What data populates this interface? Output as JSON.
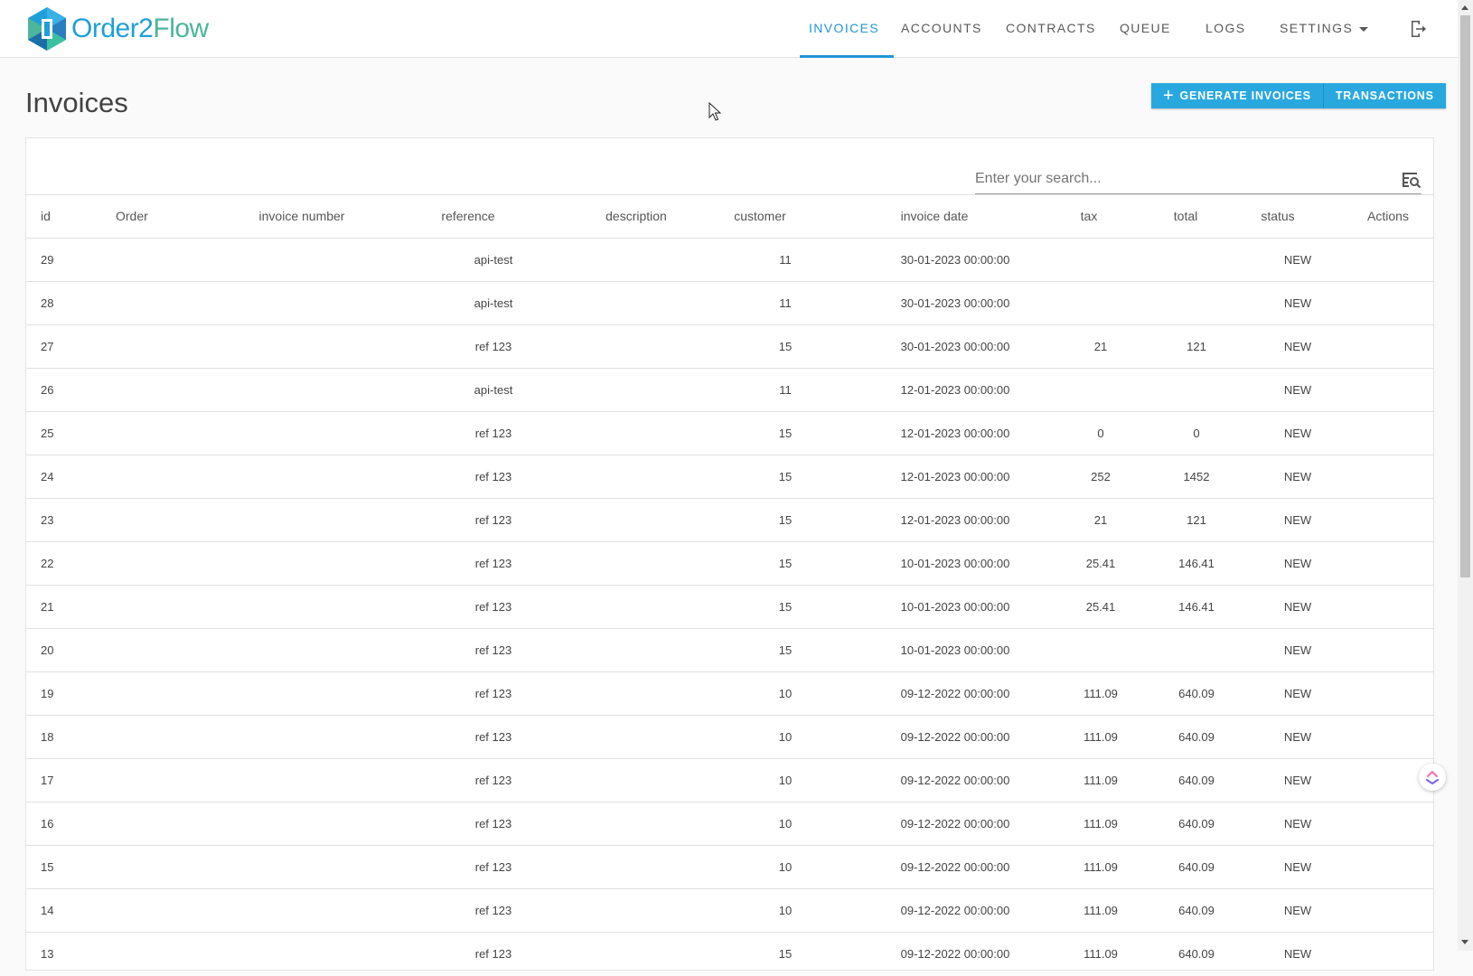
{
  "brand": {
    "name_part1": "Order2",
    "name_part2": "Flow"
  },
  "nav": {
    "items": [
      {
        "label": "INVOICES",
        "active": true
      },
      {
        "label": "ACCOUNTS",
        "active": false
      },
      {
        "label": "CONTRACTS",
        "active": false
      },
      {
        "label": "QUEUE",
        "active": false
      },
      {
        "label": "LOGS",
        "active": false
      },
      {
        "label": "SETTINGS",
        "active": false
      }
    ],
    "logout_icon": "logout-icon"
  },
  "page": {
    "title": "Invoices"
  },
  "actions": {
    "generate_label": "GENERATE INVOICES",
    "transactions_label": "TRANSACTIONS"
  },
  "search": {
    "placeholder": "Enter your search...",
    "value": ""
  },
  "table": {
    "columns": [
      "id",
      "Order",
      "invoice number",
      "reference",
      "description",
      "customer",
      "invoice date",
      "tax",
      "total",
      "status",
      "Actions"
    ],
    "rows": [
      {
        "id": "29",
        "order": "",
        "invoice_number": "",
        "reference": "api-test",
        "description": "",
        "customer": "11",
        "invoice_date": "30-01-2023 00:00:00",
        "tax": "",
        "total": "",
        "status": "NEW"
      },
      {
        "id": "28",
        "order": "",
        "invoice_number": "",
        "reference": "api-test",
        "description": "",
        "customer": "11",
        "invoice_date": "30-01-2023 00:00:00",
        "tax": "",
        "total": "",
        "status": "NEW"
      },
      {
        "id": "27",
        "order": "",
        "invoice_number": "",
        "reference": "ref 123",
        "description": "",
        "customer": "15",
        "invoice_date": "30-01-2023 00:00:00",
        "tax": "21",
        "total": "121",
        "status": "NEW"
      },
      {
        "id": "26",
        "order": "",
        "invoice_number": "",
        "reference": "api-test",
        "description": "",
        "customer": "11",
        "invoice_date": "12-01-2023 00:00:00",
        "tax": "",
        "total": "",
        "status": "NEW"
      },
      {
        "id": "25",
        "order": "",
        "invoice_number": "",
        "reference": "ref 123",
        "description": "",
        "customer": "15",
        "invoice_date": "12-01-2023 00:00:00",
        "tax": "0",
        "total": "0",
        "status": "NEW"
      },
      {
        "id": "24",
        "order": "",
        "invoice_number": "",
        "reference": "ref 123",
        "description": "",
        "customer": "15",
        "invoice_date": "12-01-2023 00:00:00",
        "tax": "252",
        "total": "1452",
        "status": "NEW"
      },
      {
        "id": "23",
        "order": "",
        "invoice_number": "",
        "reference": "ref 123",
        "description": "",
        "customer": "15",
        "invoice_date": "12-01-2023 00:00:00",
        "tax": "21",
        "total": "121",
        "status": "NEW"
      },
      {
        "id": "22",
        "order": "",
        "invoice_number": "",
        "reference": "ref 123",
        "description": "",
        "customer": "15",
        "invoice_date": "10-01-2023 00:00:00",
        "tax": "25.41",
        "total": "146.41",
        "status": "NEW"
      },
      {
        "id": "21",
        "order": "",
        "invoice_number": "",
        "reference": "ref 123",
        "description": "",
        "customer": "15",
        "invoice_date": "10-01-2023 00:00:00",
        "tax": "25.41",
        "total": "146.41",
        "status": "NEW"
      },
      {
        "id": "20",
        "order": "",
        "invoice_number": "",
        "reference": "ref 123",
        "description": "",
        "customer": "15",
        "invoice_date": "10-01-2023 00:00:00",
        "tax": "",
        "total": "",
        "status": "NEW"
      },
      {
        "id": "19",
        "order": "",
        "invoice_number": "",
        "reference": "ref 123",
        "description": "",
        "customer": "10",
        "invoice_date": "09-12-2022 00:00:00",
        "tax": "111.09",
        "total": "640.09",
        "status": "NEW"
      },
      {
        "id": "18",
        "order": "",
        "invoice_number": "",
        "reference": "ref 123",
        "description": "",
        "customer": "10",
        "invoice_date": "09-12-2022 00:00:00",
        "tax": "111.09",
        "total": "640.09",
        "status": "NEW"
      },
      {
        "id": "17",
        "order": "",
        "invoice_number": "",
        "reference": "ref 123",
        "description": "",
        "customer": "10",
        "invoice_date": "09-12-2022 00:00:00",
        "tax": "111.09",
        "total": "640.09",
        "status": "NEW"
      },
      {
        "id": "16",
        "order": "",
        "invoice_number": "",
        "reference": "ref 123",
        "description": "",
        "customer": "10",
        "invoice_date": "09-12-2022 00:00:00",
        "tax": "111.09",
        "total": "640.09",
        "status": "NEW"
      },
      {
        "id": "15",
        "order": "",
        "invoice_number": "",
        "reference": "ref 123",
        "description": "",
        "customer": "10",
        "invoice_date": "09-12-2022 00:00:00",
        "tax": "111.09",
        "total": "640.09",
        "status": "NEW"
      },
      {
        "id": "14",
        "order": "",
        "invoice_number": "",
        "reference": "ref 123",
        "description": "",
        "customer": "10",
        "invoice_date": "09-12-2022 00:00:00",
        "tax": "111.09",
        "total": "640.09",
        "status": "NEW"
      },
      {
        "id": "13",
        "order": "",
        "invoice_number": "",
        "reference": "ref 123",
        "description": "",
        "customer": "15",
        "invoice_date": "09-12-2022 00:00:00",
        "tax": "111.09",
        "total": "640.09",
        "status": "NEW"
      }
    ]
  },
  "colors": {
    "accent": "#2196d3",
    "button": "#29a8e0",
    "logo_blue": "#1f9fd8",
    "logo_green": "#4cb59b"
  }
}
